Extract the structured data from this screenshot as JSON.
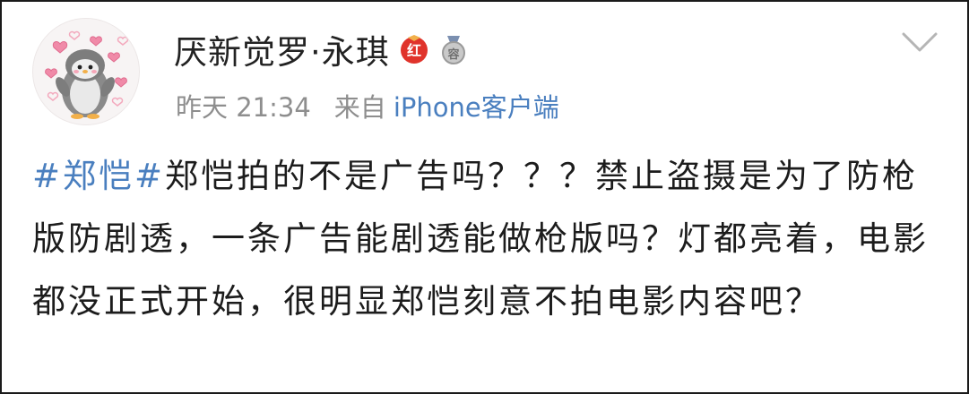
{
  "user": {
    "name": "厌新觉罗·永琪",
    "badge_red_text": "红",
    "badge_grey_text": "容"
  },
  "meta": {
    "time": "昨天 21:34",
    "from_label": "来自",
    "source": "iPhone客户端"
  },
  "post": {
    "hashtag": "#郑恺#",
    "text": "郑恺拍的不是广告吗？？？禁止盗摄是为了防枪版防剧透，一条广告能剧透能做枪版吗？灯都亮着，电影都没正式开始，很明显郑恺刻意不拍电影内容吧？"
  },
  "icons": {
    "avatar": "penguin-with-hearts-avatar",
    "more": "chevron-down-icon"
  },
  "colors": {
    "link_blue": "#4a7fbf",
    "meta_grey": "#8e8e8e",
    "badge_red": "#e0332b"
  }
}
